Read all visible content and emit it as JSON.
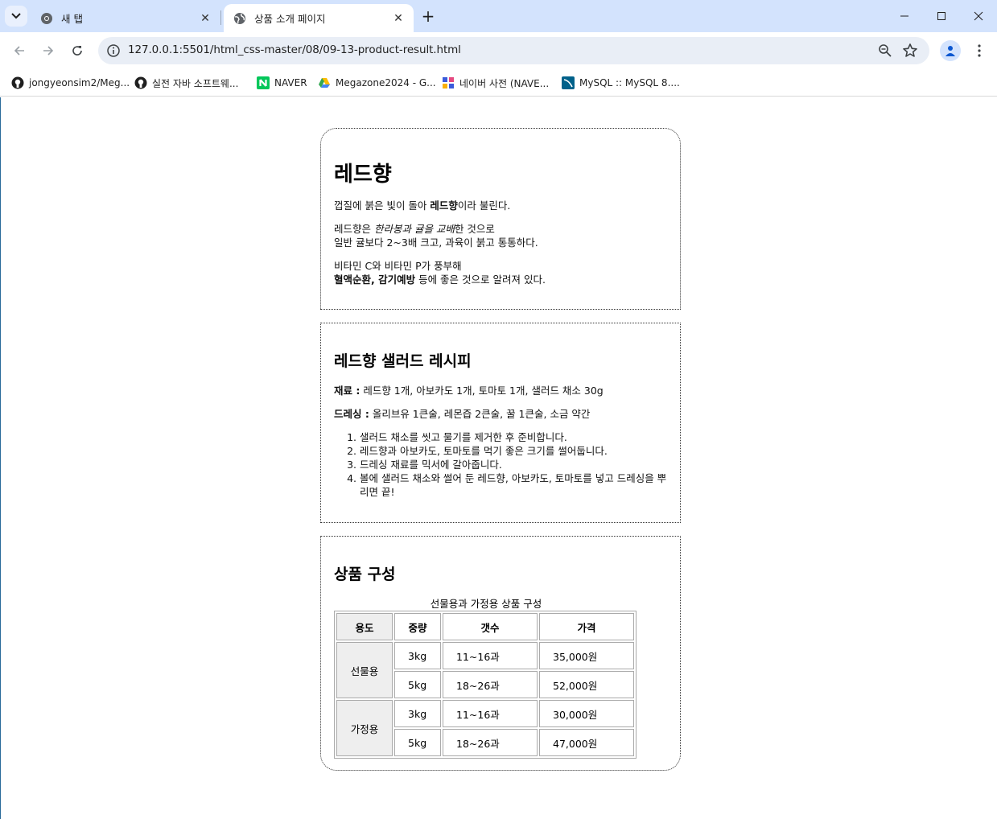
{
  "browser": {
    "tabs": [
      {
        "title": "새 탭",
        "active": false
      },
      {
        "title": "상품 소개 페이지",
        "active": true
      }
    ],
    "url": "127.0.0.1:5501/html_css-master/08/09-13-product-result.html",
    "bookmarks": [
      "jongyeonsim2/Meg...",
      "실전 자바 소프트웨...",
      "NAVER",
      "Megazone2024 - G...",
      "네이버 사전 (NAVE...",
      "MySQL :: MySQL 8...."
    ]
  },
  "intro": {
    "title": "레드향",
    "p1_pre": "껍질에 붉은 빛이 돌아 ",
    "p1_bold": "레드향",
    "p1_post": "이라 불린다.",
    "p2_pre": "레드향은 ",
    "p2_italic": "한라봉과 귤을 교배",
    "p2_post": "한 것으로",
    "p2_line2": "일반 귤보다 2~3배 크고, 과육이 붉고 통통하다.",
    "p3_line1": "비타민 C와 비타민 P가 풍부해",
    "p3_bold": "혈액순환, 감기예방",
    "p3_post": " 등에 좋은 것으로 알려져 있다."
  },
  "recipe": {
    "title": "레드향 샐러드 레시피",
    "ingredients_label": "재료 :",
    "ingredients": " 레드향 1개, 아보카도 1개, 토마토 1개, 샐러드 채소 30g",
    "dressing_label": "드레싱 :",
    "dressing": " 올리브유 1큰술, 레몬즙 2큰술, 꿀 1큰술, 소금 약간",
    "steps": [
      "샐러드 채소를 씻고 물기를 제거한 후 준비합니다.",
      "레드향과 아보카도, 토마토를 먹기 좋은 크기를 썰어둡니다.",
      "드레싱 재료를 믹서에 갈아줍니다.",
      "볼에 샐러드 채소와 썰어 둔 레드향, 아보카도, 토마토를 넣고 드레싱을 뿌리면 끝!"
    ]
  },
  "product": {
    "title": "상품 구성",
    "caption": "선물용과 가정용 상품 구성",
    "headers": [
      "용도",
      "중량",
      "갯수",
      "가격"
    ],
    "groups": [
      {
        "usage": "선물용",
        "rows": [
          [
            "3kg",
            "11~16과",
            "35,000원"
          ],
          [
            "5kg",
            "18~26과",
            "52,000원"
          ]
        ]
      },
      {
        "usage": "가정용",
        "rows": [
          [
            "3kg",
            "11~16과",
            "30,000원"
          ],
          [
            "5kg",
            "18~26과",
            "47,000원"
          ]
        ]
      }
    ]
  }
}
